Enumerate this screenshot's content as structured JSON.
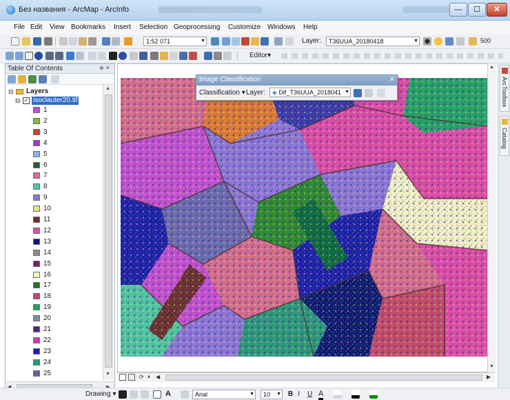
{
  "window": {
    "title": "Без названия - ArcMap - ArcInfo",
    "controls": {
      "minimize": "—",
      "maximize": "☐",
      "close": "✕"
    }
  },
  "menu": [
    "File",
    "Edit",
    "View",
    "Bookmarks",
    "Insert",
    "Selection",
    "Geoprocessing",
    "Customize",
    "Windows",
    "Help"
  ],
  "standard_toolbar": {
    "scale_value": "1:52 071",
    "layer_label": "Layer:",
    "layer_value": "T36UUA_20180418",
    "zoom_value": "500"
  },
  "editor_toolbar": {
    "editor_label": "Editor▾"
  },
  "toc": {
    "title": "Table Of Contents",
    "pin": "⊕ ✕",
    "layers_label": "Layers",
    "raster_name": "isoclauter20.tif",
    "classes": [
      {
        "label": "1",
        "color": "#c64fd1"
      },
      {
        "label": "2",
        "color": "#8ab54a"
      },
      {
        "label": "3",
        "color": "#c9402f"
      },
      {
        "label": "4",
        "color": "#a03cc4"
      },
      {
        "label": "5",
        "color": "#8fb4e0"
      },
      {
        "label": "6",
        "color": "#2f5a3a"
      },
      {
        "label": "7",
        "color": "#d86d8c"
      },
      {
        "label": "8",
        "color": "#4fc8a0"
      },
      {
        "label": "9",
        "color": "#8d76d8"
      },
      {
        "label": "10",
        "color": "#e9dd8e"
      },
      {
        "label": "11",
        "color": "#6b2f2a"
      },
      {
        "label": "12",
        "color": "#e04ba6"
      },
      {
        "label": "13",
        "color": "#0b1a6e"
      },
      {
        "label": "14",
        "color": "#8a8a8a"
      },
      {
        "label": "15",
        "color": "#7a1d6d"
      },
      {
        "label": "16",
        "color": "#f4f2c8"
      },
      {
        "label": "17",
        "color": "#2d6b2d"
      },
      {
        "label": "18",
        "color": "#c74a66"
      },
      {
        "label": "19",
        "color": "#23a364"
      },
      {
        "label": "20",
        "color": "#7a8fa8"
      },
      {
        "label": "21",
        "color": "#4a2a72"
      },
      {
        "label": "22",
        "color": "#d23ca8"
      },
      {
        "label": "23",
        "color": "#1b1fa8"
      },
      {
        "label": "24",
        "color": "#2a9a7a"
      },
      {
        "label": "25",
        "color": "#6d5ab0"
      }
    ]
  },
  "dock": {
    "toolbox_label": "ArcToolbox",
    "catalog_label": "Catalog"
  },
  "image_classification": {
    "title": "Image Classification",
    "classification_label": "Classification ▾",
    "layer_label": "Layer:",
    "layer_value": "Dif_T36UUA_2018041"
  },
  "drawing_toolbar": {
    "drawing_label": "Drawing ▾",
    "font_value": "Arial",
    "size_value": "10",
    "bold": "B",
    "italic": "I",
    "underline": "U",
    "text_a": "A"
  },
  "colors": {
    "accent": "#316ac5",
    "titlebar": "#b7d3ef"
  }
}
